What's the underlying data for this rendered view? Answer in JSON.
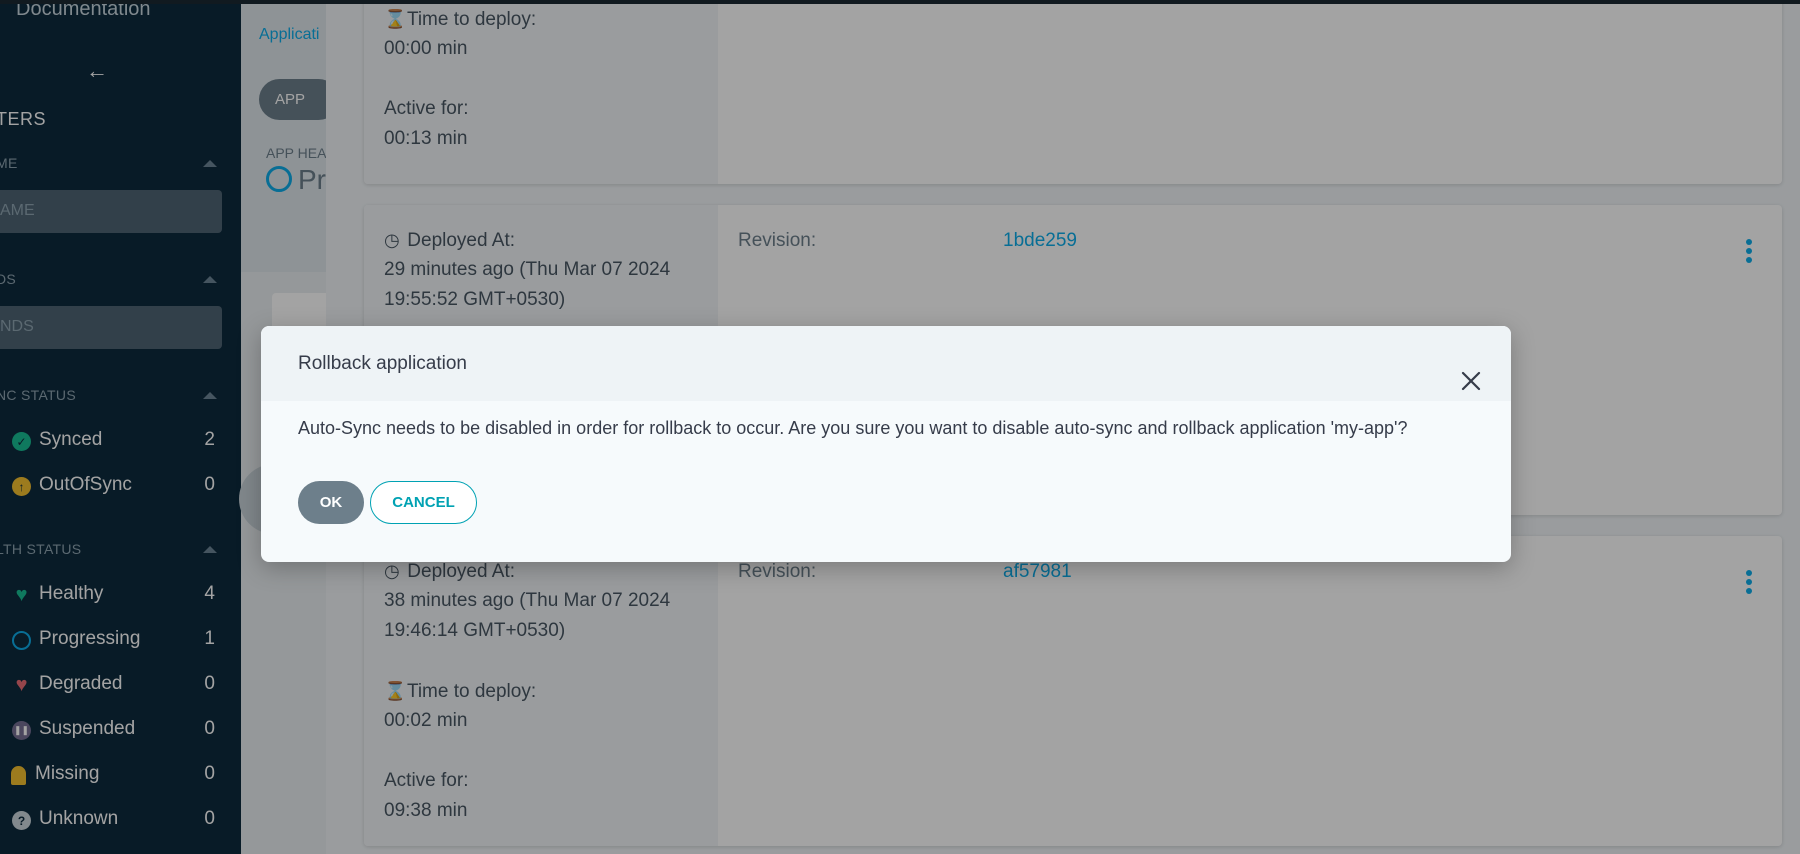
{
  "sidebar": {
    "documentation": "Documentation",
    "filters_title": "TERS",
    "name_section": "ME",
    "name_placeholder": "AME",
    "kinds_section": "DS",
    "kinds_placeholder": "NDS",
    "sync_section": "NC STATUS",
    "sync_items": [
      {
        "label": "Synced",
        "count": "2",
        "icon": "check-icon",
        "color": "#18be94"
      },
      {
        "label": "OutOfSync",
        "count": "0",
        "icon": "arrow-up-icon",
        "color": "#f4c030"
      }
    ],
    "health_section": "LTH STATUS",
    "health_items": [
      {
        "label": "Healthy",
        "count": "4",
        "icon": "heart-icon",
        "color": "#18be94"
      },
      {
        "label": "Progressing",
        "count": "1",
        "icon": "spinner-icon",
        "color": "#0dadea"
      },
      {
        "label": "Degraded",
        "count": "0",
        "icon": "broken-heart-icon",
        "color": "#e96d76"
      },
      {
        "label": "Suspended",
        "count": "0",
        "icon": "pause-icon",
        "color": "#766f94"
      },
      {
        "label": "Missing",
        "count": "0",
        "icon": "ghost-icon",
        "color": "#f4c030"
      },
      {
        "label": "Unknown",
        "count": "0",
        "icon": "question-icon",
        "color": "#ccd6dd"
      }
    ]
  },
  "main": {
    "breadcrumb": "Applicati",
    "app_pill": "APP",
    "app_health_label": "APP HEA",
    "app_health_value": "Pr"
  },
  "history": {
    "top_card": {
      "time_to_deploy_label": "Time to deploy:",
      "time_to_deploy": "00:00 min",
      "active_for_label": "Active for:",
      "active_for": "00:13 min"
    },
    "card_2": {
      "deployed_at_label": "Deployed At:",
      "deployed_at_line1": "29 minutes ago (Thu Mar 07 2024",
      "deployed_at_line2": "19:55:52 GMT+0530)",
      "revision_label": "Revision:",
      "revision": "1bde259"
    },
    "card_3": {
      "deployed_at_label": "Deployed At:",
      "deployed_at_line1": "38 minutes ago (Thu Mar 07 2024",
      "deployed_at_line2": "19:46:14 GMT+0530)",
      "revision_label": "Revision:",
      "revision": "af57981",
      "time_to_deploy_label": "Time to deploy:",
      "time_to_deploy": "00:02 min",
      "active_for_label": "Active for:",
      "active_for": "09:38 min"
    }
  },
  "dialog": {
    "title": "Rollback application",
    "message": "Auto-Sync needs to be disabled in order for rollback to occur. Are you sure you want to disable auto-sync and rollback application 'my-app'?",
    "ok_label": "OK",
    "cancel_label": "CANCEL"
  }
}
